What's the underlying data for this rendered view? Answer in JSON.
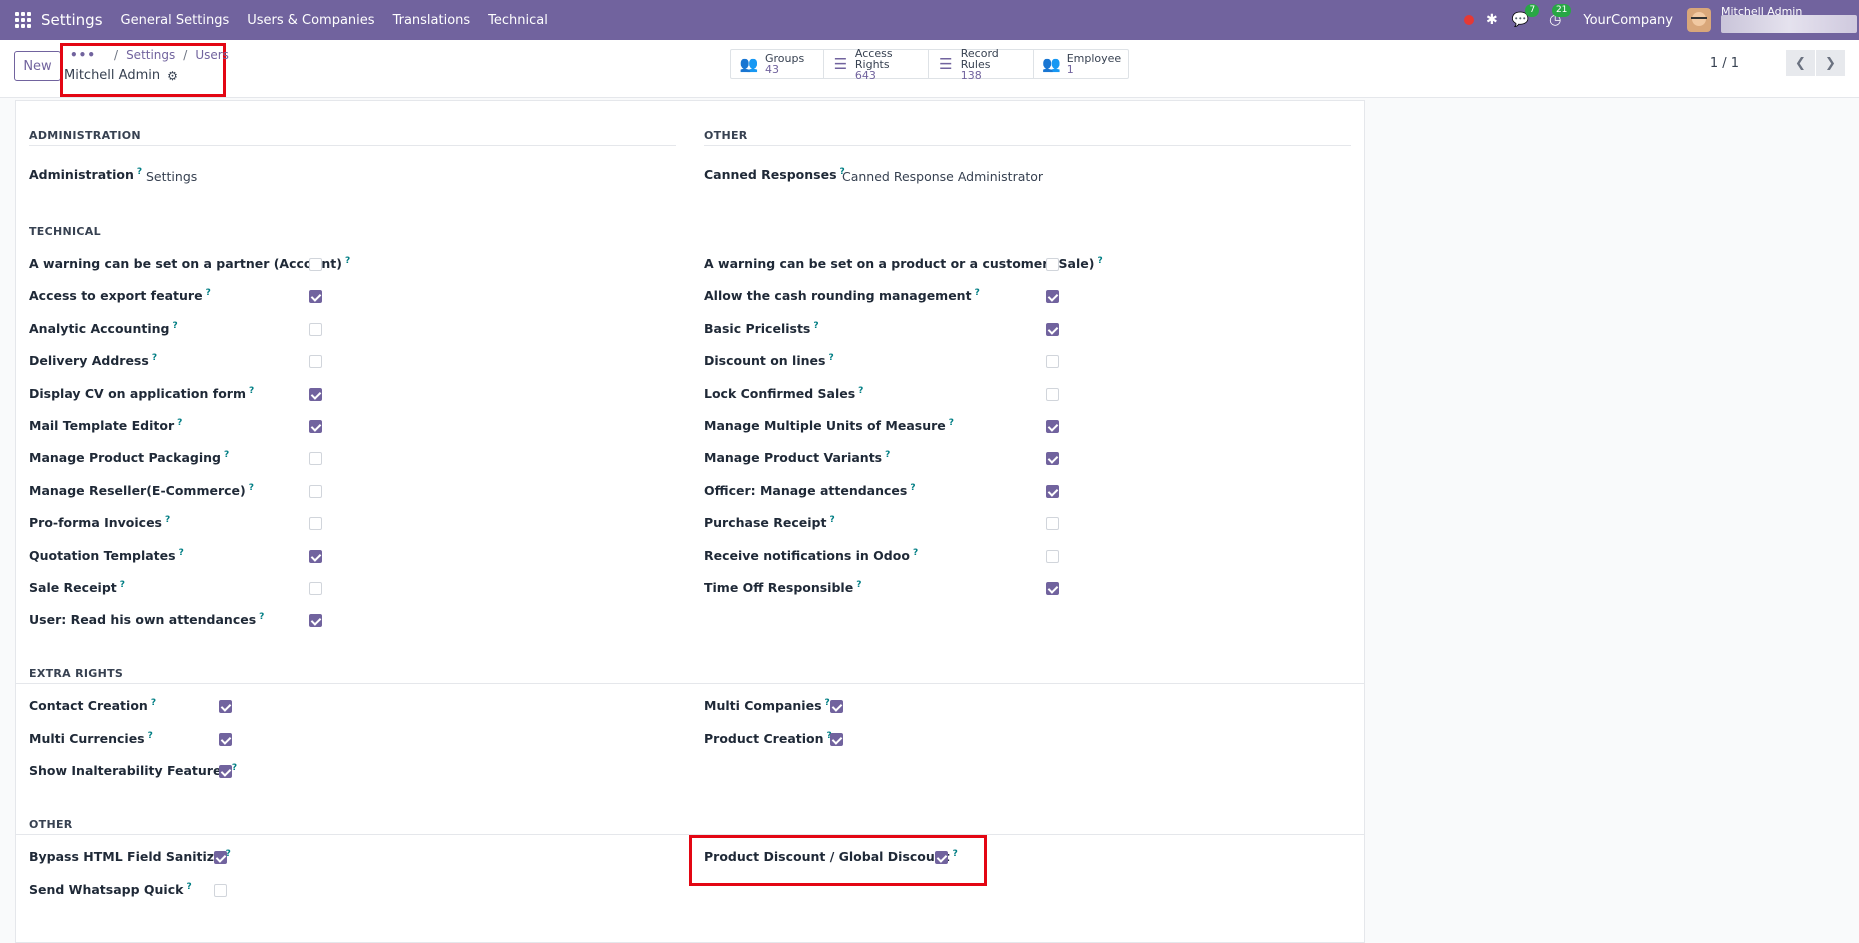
{
  "navbar": {
    "app_name": "Settings",
    "menu": [
      "General Settings",
      "Users & Companies",
      "Translations",
      "Technical"
    ],
    "chat_badge": "7",
    "activity_badge": "21",
    "company": "YourCompany",
    "user_name": "Mitchell Admin"
  },
  "control": {
    "new_label": "New",
    "breadcrumb_dots": "•••",
    "breadcrumbs": [
      "Settings",
      "Users"
    ],
    "record_title": "Mitchell Admin",
    "stats": [
      {
        "label": "Groups",
        "value": "43",
        "icon": "users-icon"
      },
      {
        "label": "Access Rights",
        "value": "643",
        "icon": "list-icon"
      },
      {
        "label": "Record Rules",
        "value": "138",
        "icon": "list-icon"
      },
      {
        "label": "Employee",
        "value": "1",
        "icon": "users-icon"
      }
    ],
    "pager": "1 / 1"
  },
  "sections": {
    "administration": {
      "title": "ADMINISTRATION",
      "label": "Administration",
      "value": "Settings"
    },
    "other_top": {
      "title": "OTHER",
      "label": "Canned Responses",
      "value": "Canned Response Administrator"
    },
    "technical": {
      "title": "TECHNICAL",
      "left": [
        {
          "label": "A warning can be set on a partner (Account)",
          "checked": false
        },
        {
          "label": "Access to export feature",
          "checked": true
        },
        {
          "label": "Analytic Accounting",
          "checked": false
        },
        {
          "label": "Delivery Address",
          "checked": false
        },
        {
          "label": "Display CV on application form",
          "checked": true
        },
        {
          "label": "Mail Template Editor",
          "checked": true
        },
        {
          "label": "Manage Product Packaging",
          "checked": false
        },
        {
          "label": "Manage Reseller(E-Commerce)",
          "checked": false
        },
        {
          "label": "Pro-forma Invoices",
          "checked": false
        },
        {
          "label": "Quotation Templates",
          "checked": true
        },
        {
          "label": "Sale Receipt",
          "checked": false
        },
        {
          "label": "User: Read his own attendances",
          "checked": true
        }
      ],
      "right": [
        {
          "label": "A warning can be set on a product or a customer (Sale)",
          "checked": false
        },
        {
          "label": "Allow the cash rounding management",
          "checked": true
        },
        {
          "label": "Basic Pricelists",
          "checked": true
        },
        {
          "label": "Discount on lines",
          "checked": false
        },
        {
          "label": "Lock Confirmed Sales",
          "checked": false
        },
        {
          "label": "Manage Multiple Units of Measure",
          "checked": true
        },
        {
          "label": "Manage Product Variants",
          "checked": true
        },
        {
          "label": "Officer: Manage attendances",
          "checked": true
        },
        {
          "label": "Purchase Receipt",
          "checked": false
        },
        {
          "label": "Receive notifications in Odoo",
          "checked": false
        },
        {
          "label": "Time Off Responsible",
          "checked": true
        }
      ]
    },
    "extra_rights": {
      "title": "EXTRA RIGHTS",
      "left": [
        {
          "label": "Contact Creation",
          "checked": true
        },
        {
          "label": "Multi Currencies",
          "checked": true
        },
        {
          "label": "Show Inalterability Features",
          "checked": true
        }
      ],
      "right": [
        {
          "label": "Multi Companies",
          "checked": true
        },
        {
          "label": "Product Creation",
          "checked": true
        }
      ]
    },
    "other_bottom": {
      "title": "OTHER",
      "left": [
        {
          "label": "Bypass HTML Field Sanitize",
          "checked": true
        },
        {
          "label": "Send Whatsapp Quick",
          "checked": false
        }
      ],
      "right": [
        {
          "label": "Product Discount / Global Discount",
          "checked": true
        }
      ]
    }
  }
}
